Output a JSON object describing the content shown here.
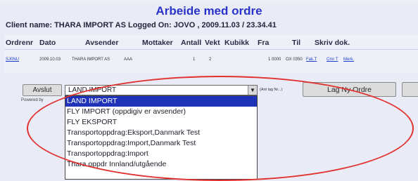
{
  "title": "Arbeide med ordre",
  "client_line": "Client name: THARA IMPORT AS Logged On: JOVO , 2009.11.03 / 23.34.41",
  "table": {
    "headers": [
      "Ordrenr",
      "Dato",
      "Avsender",
      "Mottaker",
      "Antall",
      "Vekt",
      "Kubikk",
      "Fra",
      "Til",
      "Skriv dok."
    ],
    "row": {
      "ordrenr": "SJ0NU",
      "dato": "2009.10.03",
      "avsender": "THARA IMPORT AS",
      "mottaker": "AAA",
      "antall": "1",
      "vekt": "2",
      "fra": "1 0000",
      "til": "OX 0350",
      "links": [
        "Fak.T",
        "Cmr T",
        "Merk."
      ]
    }
  },
  "controls": {
    "avslut_label": "Avslut",
    "select_value": "LAND IMPORT",
    "arrow": "▼",
    "note": "(Ant lag Nr...)",
    "new_order_label": "Lag Ny Ordre",
    "powered": "Powered by"
  },
  "dropdown": {
    "options": [
      "LAND IMPORT",
      "FLY IMPORT (oppdigiv er avsender)",
      "FLY EKSPORT",
      "Transportoppdrag:Eksport,Danmark Test",
      "Transportoppdrag:Import,Danmark Test",
      "Transportoppdrag:Import",
      "Thara oppdr Innland/utgående"
    ],
    "selected_index": 0
  },
  "colors": {
    "title": "#2a33c9",
    "highlight": "#1e33b8",
    "annotation": "#e2322f"
  }
}
